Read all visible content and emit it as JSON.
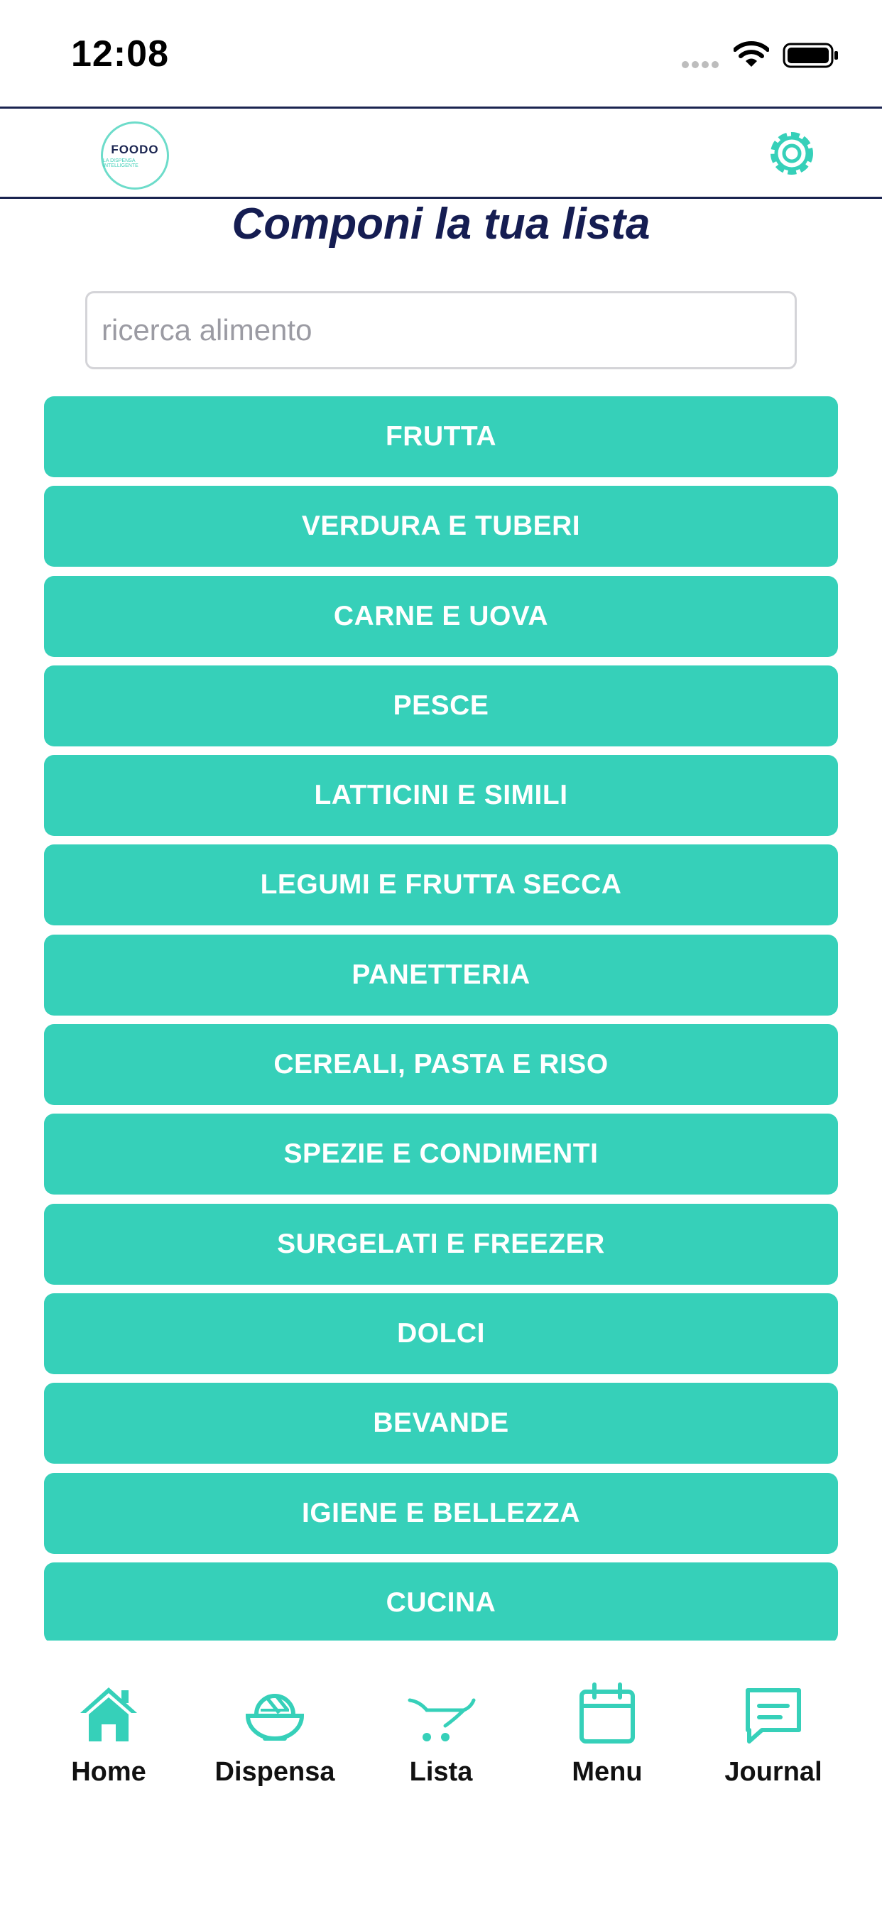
{
  "status_bar": {
    "time": "12:08"
  },
  "header": {
    "logo_text": "FOODO",
    "logo_subtext": "LA DISPENSA INTELLIGENTE"
  },
  "page": {
    "title": "Componi la tua lista"
  },
  "search": {
    "placeholder": "ricerca alimento",
    "value": ""
  },
  "categories": [
    "FRUTTA",
    "VERDURA E TUBERI",
    "CARNE E UOVA",
    "PESCE",
    "LATTICINI E SIMILI",
    "LEGUMI E FRUTTA SECCA",
    "PANETTERIA",
    "CEREALI, PASTA E RISO",
    "SPEZIE E CONDIMENTI",
    "SURGELATI E FREEZER",
    "DOLCI",
    "BEVANDE",
    "IGIENE E BELLEZZA",
    "CUCINA"
  ],
  "tabs": [
    {
      "label": "Home",
      "icon": "home-icon"
    },
    {
      "label": "Dispensa",
      "icon": "bowl-icon"
    },
    {
      "label": "Lista",
      "icon": "cart-icon"
    },
    {
      "label": "Menu",
      "icon": "calendar-icon"
    },
    {
      "label": "Journal",
      "icon": "chat-icon"
    }
  ],
  "colors": {
    "accent": "#36d0b9",
    "title": "#151d52",
    "header_border": "#1a2450"
  }
}
